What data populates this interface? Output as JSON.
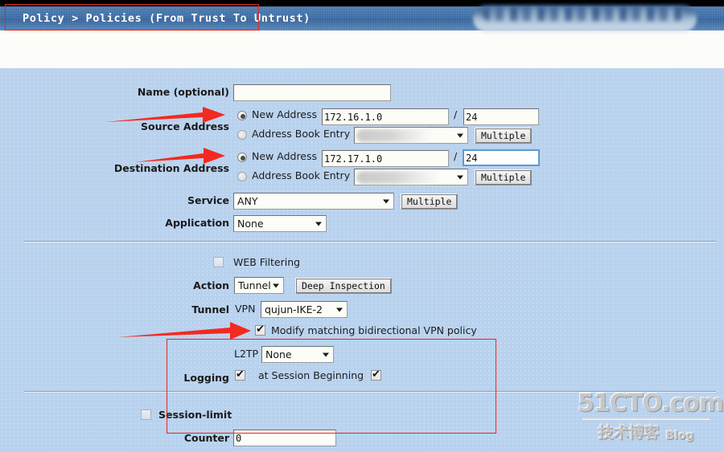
{
  "window": {
    "breadcrumb": "Policy > Policies (From Trust To Untrust)",
    "accent_red": "#e8271f",
    "titlebar_blue": "#3d6da4",
    "form_bg": "#b9d2ee"
  },
  "form": {
    "name": {
      "label": "Name (optional)",
      "value": "",
      "placeholder": ""
    },
    "source_address": {
      "label": "Source Address",
      "new_address_label": "New Address",
      "new_address_selected": true,
      "address": "172.16.1.0",
      "slash": "/",
      "netmask": "24",
      "address_book_label": "Address Book Entry",
      "address_book_selected": false,
      "address_book_value": "",
      "multiple_button": "Multiple"
    },
    "destination_address": {
      "label": "Destination Address",
      "new_address_label": "New Address",
      "new_address_selected": true,
      "address": "172.17.1.0",
      "slash": "/",
      "netmask": "24",
      "address_book_label": "Address Book Entry",
      "address_book_selected": false,
      "address_book_value": "",
      "multiple_button": "Multiple"
    },
    "service": {
      "label": "Service",
      "value": "ANY",
      "multiple_button": "Multiple"
    },
    "application": {
      "label": "Application",
      "value": "None"
    },
    "web_filtering": {
      "label": "WEB Filtering",
      "checked": false
    },
    "action": {
      "label": "Action",
      "value": "Tunnel",
      "deep_inspection_button": "Deep Inspection"
    },
    "tunnel": {
      "label": "Tunnel",
      "vpn_label": "VPN",
      "vpn_value": "qujun-IKE-2",
      "modify_bidirectional_label": "Modify matching bidirectional VPN policy",
      "modify_bidirectional_checked": true,
      "l2tp_label": "L2TP",
      "l2tp_value": "None"
    },
    "logging": {
      "label": "Logging",
      "checked": true,
      "session_beginning_label": "at Session Beginning",
      "session_beginning_checked": true
    },
    "session_limit": {
      "label": "Session-limit",
      "checked": false,
      "counter_label": "Counter",
      "counter_value": "0"
    }
  },
  "watermark": {
    "top": "51CTO.com",
    "cn": "技术博客",
    "blog": "Blog"
  }
}
